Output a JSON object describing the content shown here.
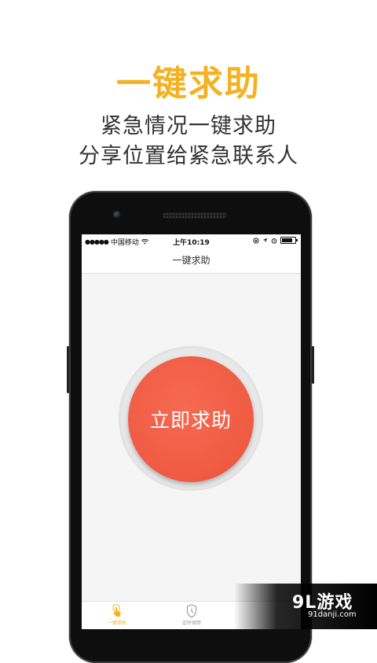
{
  "promo": {
    "headline": "一键求助",
    "subtitle_line1": "紧急情况一键求助",
    "subtitle_line2": "分享位置给紧急联系人"
  },
  "status_bar": {
    "signal_dots": "●●●●●",
    "carrier": "中国移动",
    "time": "上午10:19"
  },
  "app": {
    "nav_title": "一键求助",
    "sos_button_label": "立即求助",
    "tabs": [
      {
        "label": "一键求助",
        "icon": "hand-tap-icon",
        "active": true
      },
      {
        "label": "定时保障",
        "icon": "shield-clock-icon",
        "active": false
      }
    ]
  },
  "watermark": {
    "brand": "9L游戏",
    "url": "91danji.com"
  },
  "colors": {
    "accent": "#f4b223",
    "sos_red": "#ef5a42"
  }
}
